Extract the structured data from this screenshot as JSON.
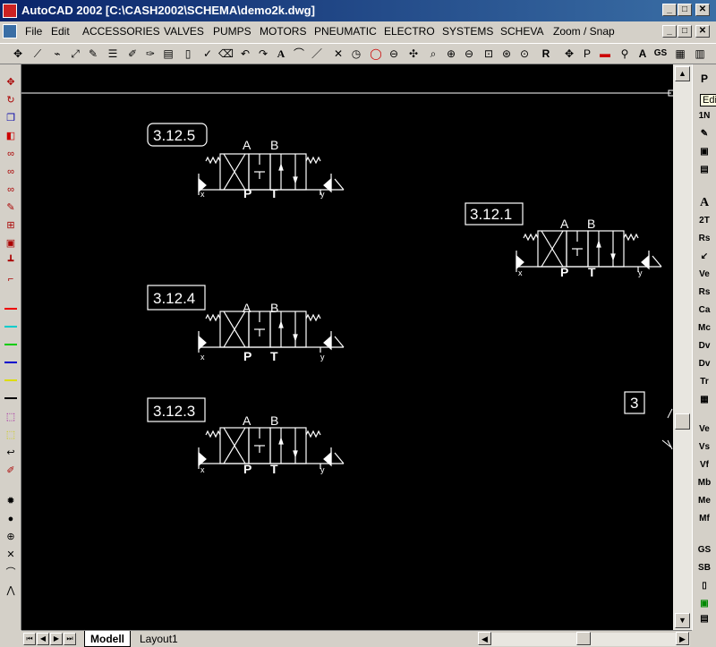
{
  "window": {
    "title": "AutoCAD 2002    [C:\\CASH2002\\SCHEMA\\demo2k.dwg]",
    "min_symbol": "_",
    "max_symbol": "□",
    "close_symbol": "✕"
  },
  "menu": {
    "items": [
      "File",
      "Edit",
      "ACCESSORIES",
      "VALVES",
      "PUMPS",
      "MOTORS",
      "PNEUMATIC",
      "ELECTRO",
      "SYSTEMS",
      "SCHEVA",
      "Zoom / Snap"
    ]
  },
  "drawing": {
    "valves": [
      {
        "label": "3.12.5",
        "port_a": "A",
        "port_b": "B",
        "port_p": "P",
        "port_t": "T",
        "port_x": "x",
        "port_y": "y"
      },
      {
        "label": "3.12.1",
        "port_a": "A",
        "port_b": "B",
        "port_p": "P",
        "port_t": "T",
        "port_x": "x",
        "port_y": "y"
      },
      {
        "label": "3.12.4",
        "port_a": "A",
        "port_b": "B",
        "port_p": "P",
        "port_t": "T",
        "port_x": "x",
        "port_y": "y"
      },
      {
        "label": "3.12.3",
        "port_a": "A",
        "port_b": "B",
        "port_p": "P",
        "port_t": "T",
        "port_x": "x",
        "port_y": "y"
      }
    ],
    "extra_label": "3"
  },
  "tabs": {
    "model": "Modell",
    "layout": "Layout1"
  },
  "right_toolbar": {
    "tooltip": "Edi",
    "items": [
      "P",
      "1N",
      "2T",
      "Rs",
      "Ca",
      "Mc",
      "Dv",
      "Tr",
      "Ve",
      "Vs",
      "Vf",
      "Mb",
      "Me",
      "Mf",
      "GS",
      "SB"
    ]
  },
  "colors": {
    "canvas": "#000000",
    "title_bar": "#0a246a",
    "chrome": "#d4d0c8"
  }
}
